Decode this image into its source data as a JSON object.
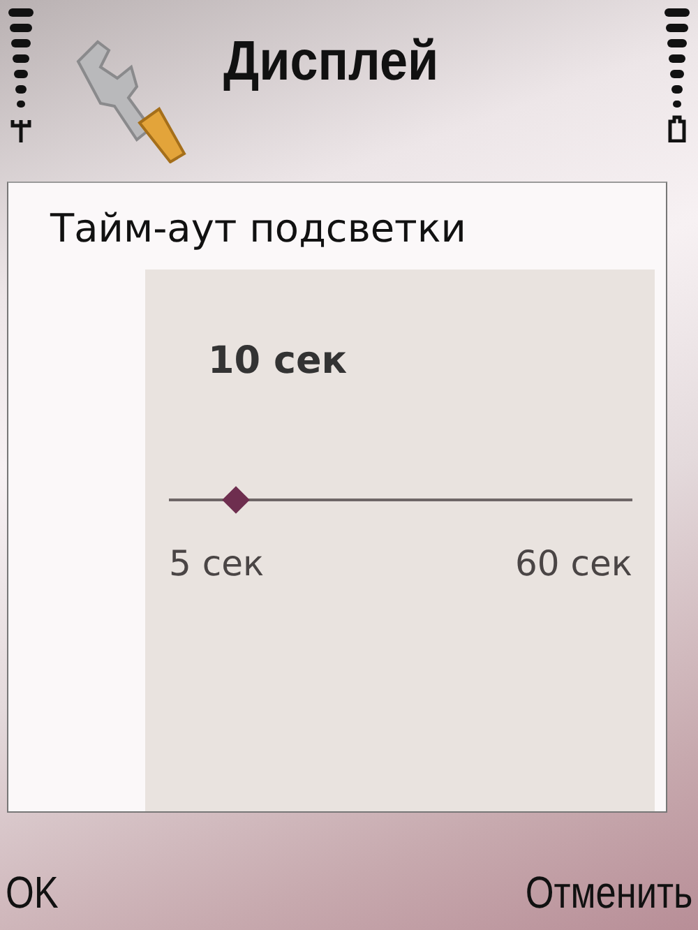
{
  "header": {
    "title": "Дисплей"
  },
  "dialog": {
    "title": "Тайм-аут подсветки",
    "value": "10 сек",
    "slider": {
      "level": 0.13,
      "min_label": "5 сек",
      "max_label": "60 сек"
    }
  },
  "softkeys": {
    "left": "OK",
    "right": "Отменить"
  }
}
